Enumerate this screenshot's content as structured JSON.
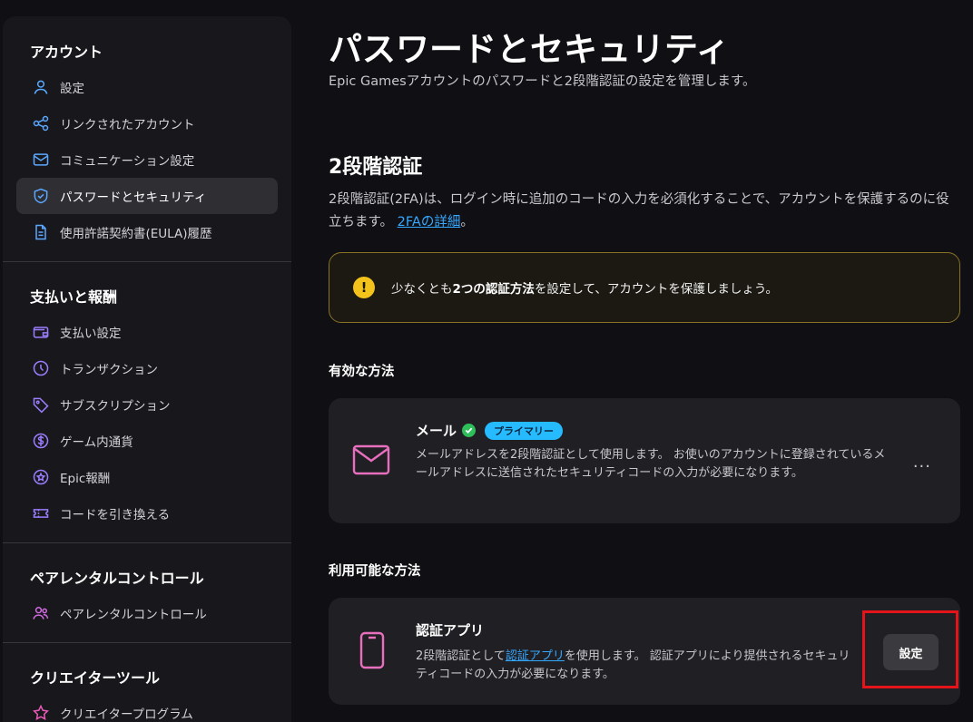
{
  "sidebar": {
    "account": {
      "title": "アカウント",
      "items": [
        {
          "label": "設定",
          "icon": "user-icon"
        },
        {
          "label": "リンクされたアカウント",
          "icon": "share-icon"
        },
        {
          "label": "コミュニケーション設定",
          "icon": "mail-icon"
        },
        {
          "label": "パスワードとセキュリティ",
          "icon": "shield-icon",
          "active": true
        },
        {
          "label": "使用許諾契約書(EULA)履歴",
          "icon": "document-icon"
        }
      ]
    },
    "payments": {
      "title": "支払いと報酬",
      "items": [
        {
          "label": "支払い設定",
          "icon": "wallet-icon"
        },
        {
          "label": "トランザクション",
          "icon": "clock-icon"
        },
        {
          "label": "サブスクリプション",
          "icon": "tag-icon"
        },
        {
          "label": "ゲーム内通貨",
          "icon": "dollar-icon"
        },
        {
          "label": "Epic報酬",
          "icon": "star-icon"
        },
        {
          "label": "コードを引き換える",
          "icon": "ticket-icon"
        }
      ]
    },
    "parental": {
      "title": "ペアレンタルコントロール",
      "items": [
        {
          "label": "ペアレンタルコントロール",
          "icon": "people-icon"
        }
      ]
    },
    "creator": {
      "title": "クリエイターツール",
      "items": [
        {
          "label": "クリエイタープログラム",
          "icon": "star-icon"
        }
      ]
    }
  },
  "main": {
    "title": "パスワードとセキュリティ",
    "subtitle": "Epic Gamesアカウントのパスワードと2段階認証の設定を管理します。",
    "twofa": {
      "title": "2段階認証",
      "description": "2段階認証(2FA)は、ログイン時に追加のコードの入力を必須化することで、アカウントを保護するのに役立ちます。",
      "link": "2FAの詳細",
      "link_suffix": "。"
    },
    "warning": {
      "prefix": "少なくとも",
      "bold": "2つの認証方法",
      "suffix": "を設定して、アカウントを保護しましょう。"
    },
    "active_methods": {
      "heading": "有効な方法",
      "email": {
        "title": "メール",
        "badge": "プライマリー",
        "description": "メールアドレスを2段階認証として使用します。 お使いのアカウントに登録されているメールアドレスに送信されたセキュリティコードの入力が必要になります。",
        "menu": "..."
      }
    },
    "available_methods": {
      "heading": "利用可能な方法",
      "auth_app": {
        "title": "認証アプリ",
        "desc_prefix": "2段階認証として",
        "desc_link": "認証アプリ",
        "desc_suffix": "を使用します。 認証アプリにより提供されるセキュリティコードの入力が必要になります。",
        "button": "設定"
      }
    }
  },
  "colors": {
    "accent": "#26bbff",
    "link": "#35a8ff",
    "warning": "#f3c21b",
    "success": "#2fbf5a",
    "highlight": "#e3151a"
  }
}
